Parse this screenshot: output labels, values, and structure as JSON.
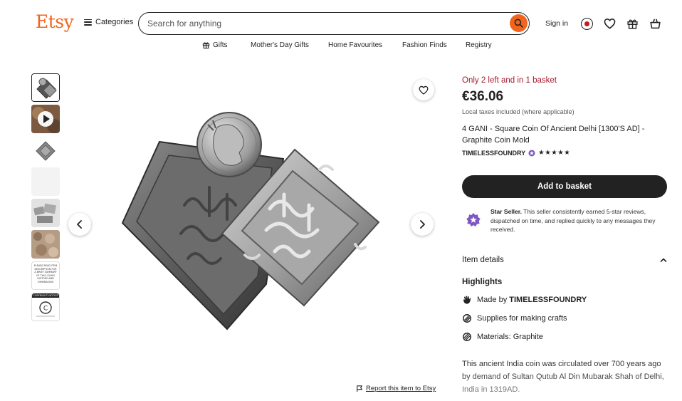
{
  "header": {
    "logo": "Etsy",
    "categories_label": "Categories",
    "search_placeholder": "Search for anything",
    "signin_label": "Sign in"
  },
  "subnav": {
    "items": [
      "Gifts",
      "Mother's Day Gifts",
      "Home Favourites",
      "Fashion Finds",
      "Registry"
    ]
  },
  "gallery": {
    "thumb_count": 8,
    "active_index": 0,
    "thumb_notice_text": "PLEASE READ ITEM DESCRIPTION FOR A BRIEF SUMMARY OF THIS COIN'S HISTORY AND DIMENSIONS",
    "thumb_copyright_text": "COPYRIGHT NOTICE",
    "report_label": "Report this item to Etsy"
  },
  "product": {
    "stock_note": "Only 2 left and in 1 basket",
    "price": "€36.06",
    "tax_note": "Local taxes included (where applicable)",
    "title": "4 GANI - Square Coin Of Ancient Delhi [1300'S AD] - Graphite Coin Mold",
    "shop_name": "TIMELESSFOUNDRY",
    "rating_stars": "★★★★★",
    "rating": 5,
    "add_to_basket_label": "Add to basket"
  },
  "seller": {
    "badge_label": "Star Seller.",
    "text": "This seller consistently earned 5-star reviews, dispatched on time, and replied quickly to any messages they received."
  },
  "details": {
    "item_details_label": "Item details",
    "highlights_label": "Highlights",
    "made_by_prefix": "Made by",
    "made_by_shop": "TIMELESSFOUNDRY",
    "supplies_label": "Supplies for making crafts",
    "materials_label": "Materials: Graphite",
    "description": "This ancient India coin was circulated over 700 years ago by demand of Sultan Qutub Al Din Mubarak Shah of Delhi, India in 1319AD."
  },
  "colors": {
    "brand": "#f1641e",
    "stock": "#a61a2e",
    "button": "#222222",
    "star_seller": "#7e57c2"
  }
}
